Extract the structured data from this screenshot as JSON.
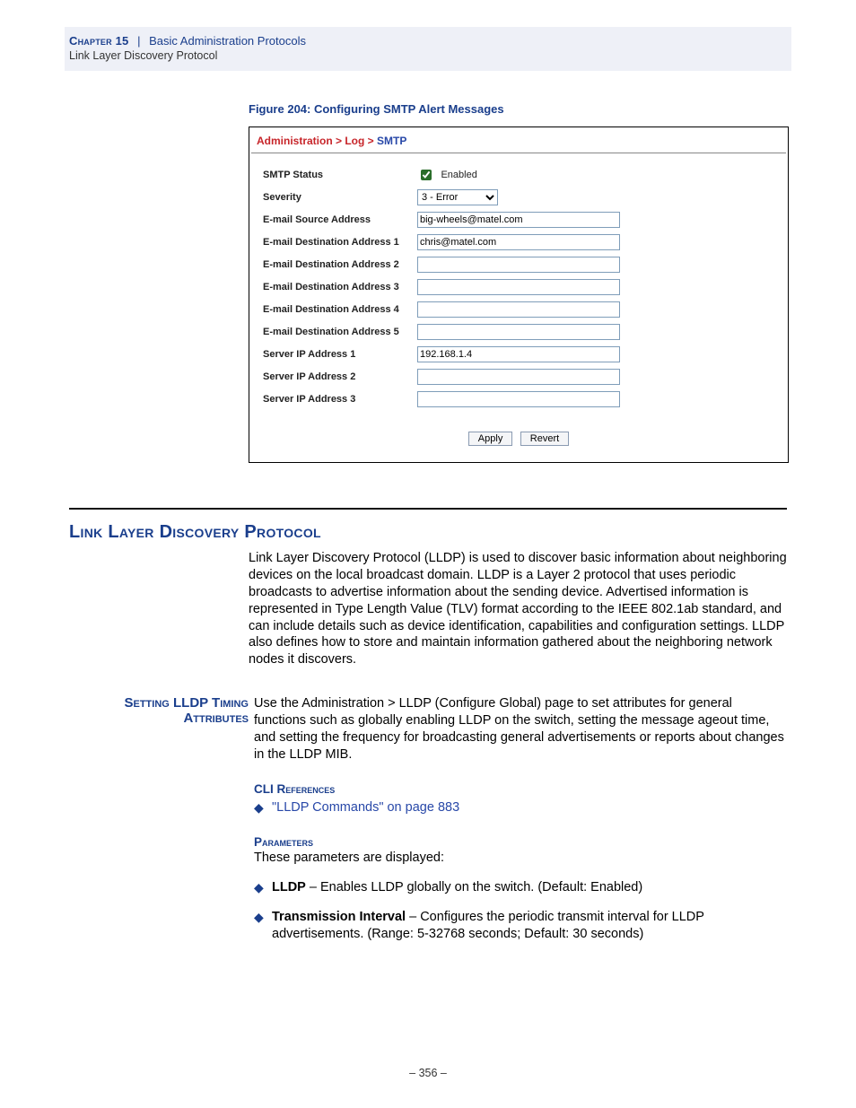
{
  "header": {
    "chapter": "Chapter 15",
    "title": "Basic Administration Protocols",
    "subtitle": "Link Layer Discovery Protocol"
  },
  "figure": {
    "caption": "Figure 204:  Configuring SMTP Alert Messages",
    "breadcrumb": "Administration > Log > ",
    "breadcrumb_last": "SMTP",
    "rows": {
      "smtp_status": {
        "label": "SMTP Status",
        "cb_label": "Enabled",
        "checked": true
      },
      "severity": {
        "label": "Severity",
        "value": "3 - Error"
      },
      "src": {
        "label": "E-mail Source Address",
        "value": "big-wheels@matel.com"
      },
      "d1": {
        "label": "E-mail Destination Address 1",
        "value": "chris@matel.com"
      },
      "d2": {
        "label": "E-mail Destination Address 2",
        "value": ""
      },
      "d3": {
        "label": "E-mail Destination Address 3",
        "value": ""
      },
      "d4": {
        "label": "E-mail Destination Address 4",
        "value": ""
      },
      "d5": {
        "label": "E-mail Destination Address 5",
        "value": ""
      },
      "s1": {
        "label": "Server IP Address 1",
        "value": "192.168.1.4"
      },
      "s2": {
        "label": "Server IP Address 2",
        "value": ""
      },
      "s3": {
        "label": "Server IP Address 3",
        "value": ""
      }
    },
    "buttons": {
      "apply": "Apply",
      "revert": "Revert"
    }
  },
  "section": {
    "h2": "Link Layer Discovery Protocol",
    "para1": "Link Layer Discovery Protocol (LLDP) is used to discover basic information about neighboring devices on the local broadcast domain. LLDP is a Layer 2 protocol that uses periodic broadcasts to advertise information about the sending device. Advertised information is represented in Type Length Value (TLV) format according to the IEEE 802.1ab standard, and can include details such as device identification, capabilities and configuration settings. LLDP also defines how to store and maintain information gathered about the neighboring network nodes it discovers.",
    "side_head": "Setting LLDP Timing Attributes",
    "para2": "Use the Administration > LLDP (Configure Global) page to set attributes for general functions such as globally enabling LLDP on the switch, setting the message ageout time, and setting the frequency for broadcasting general advertisements or reports about changes in the LLDP MIB.",
    "cli_head": "CLI References",
    "cli_link": "\"LLDP Commands\" on page 883",
    "params_head": "Parameters",
    "params_intro": "These parameters are displayed:",
    "b1_strong": "LLDP",
    "b1_rest": " – Enables LLDP globally on the switch. (Default: Enabled)",
    "b2_strong": "Transmission Interval",
    "b2_rest": " – Configures the periodic transmit interval for LLDP advertisements. (Range: 5-32768 seconds; Default: 30 seconds)"
  },
  "footer": "–  356  –"
}
